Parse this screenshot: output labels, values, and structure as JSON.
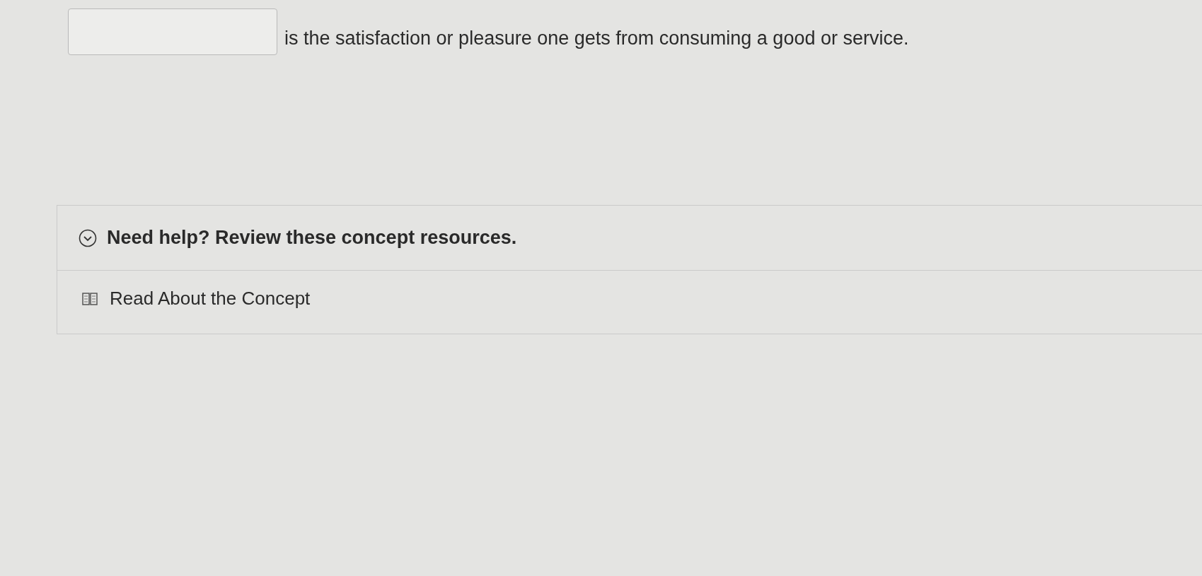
{
  "question": {
    "text": "is the satisfaction or pleasure one gets from consuming a good or service."
  },
  "help": {
    "title": "Need help? Review these concept resources.",
    "expanded": true,
    "resources": [
      {
        "label": "Read About the Concept"
      }
    ]
  }
}
